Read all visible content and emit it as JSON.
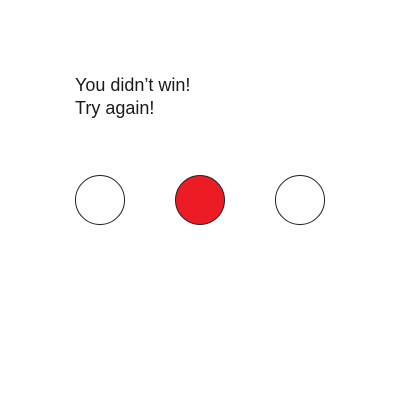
{
  "message": {
    "line1": "You didn’t win!",
    "line2": "Try again!"
  },
  "circles": [
    {
      "id": "left",
      "selected": false,
      "fill": "#ffffff"
    },
    {
      "id": "middle",
      "selected": true,
      "fill": "#ed1c24"
    },
    {
      "id": "right",
      "selected": false,
      "fill": "#ffffff"
    }
  ],
  "colors": {
    "selected": "#ed1c24",
    "unselected": "#ffffff",
    "outline": "#222222",
    "text": "#1a1a1a"
  }
}
